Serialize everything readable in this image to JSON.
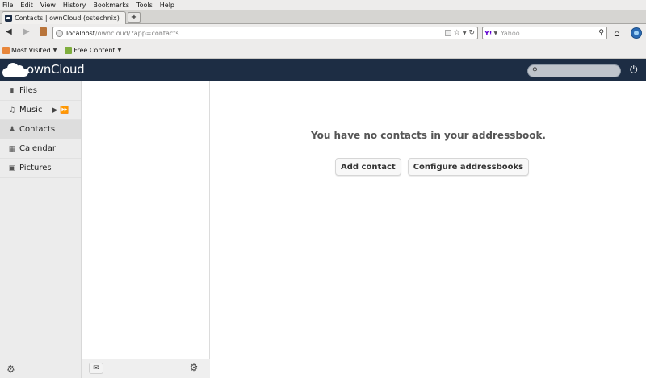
{
  "browser": {
    "menu": [
      "File",
      "Edit",
      "View",
      "History",
      "Bookmarks",
      "Tools",
      "Help"
    ],
    "tab_title": "Contacts | ownCloud (ostechnix)",
    "new_tab_label": "+",
    "url_host": "localhost",
    "url_path": "/owncloud/?app=contacts",
    "search_engine": "Yahoo",
    "bookmarks": [
      {
        "label": "Most Visited"
      },
      {
        "label": "Free Content"
      }
    ]
  },
  "app": {
    "brand": "ownCloud",
    "nav": [
      {
        "label": "Files",
        "icon": "folder-icon"
      },
      {
        "label": "Music",
        "icon": "music-note-icon"
      },
      {
        "label": "Contacts",
        "icon": "people-icon",
        "active": true
      },
      {
        "label": "Calendar",
        "icon": "calendar-icon"
      },
      {
        "label": "Pictures",
        "icon": "picture-icon"
      }
    ],
    "empty_message": "You have no contacts in your addressbook.",
    "add_contact_label": "Add contact",
    "configure_label": "Configure addressbooks"
  },
  "colors": {
    "header_bg": "#1d2d44",
    "nav_bg": "#ececec",
    "active_nav": "#dddddd"
  }
}
